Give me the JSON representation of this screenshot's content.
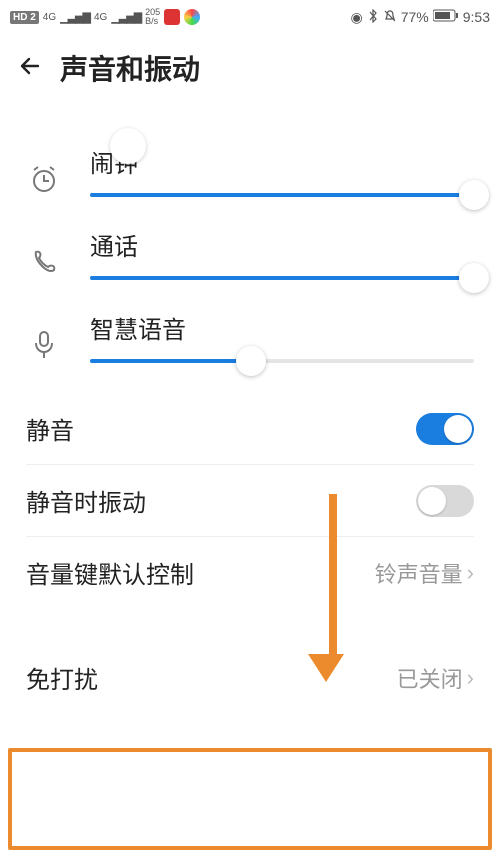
{
  "status": {
    "hd_badge": "HD 2",
    "net_4g_a": "4G",
    "net_4g_b": "4G",
    "speed": "205",
    "speed_unit": "B/s",
    "battery_pct": "77%",
    "time": "9:53"
  },
  "header": {
    "title": "声音和振动"
  },
  "sliders": [
    {
      "key": "alarm",
      "label": "闹钟",
      "value_pct": 100
    },
    {
      "key": "call",
      "label": "通话",
      "value_pct": 100
    },
    {
      "key": "voice_assist",
      "label": "智慧语音",
      "value_pct": 42
    }
  ],
  "settings": {
    "silent": {
      "label": "静音",
      "on": true
    },
    "vibrate_on_silent": {
      "label": "静音时振动",
      "on": false
    },
    "volume_key_default": {
      "label": "音量键默认控制",
      "value": "铃声音量"
    },
    "dnd": {
      "label": "免打扰",
      "value": "已关闭"
    }
  }
}
